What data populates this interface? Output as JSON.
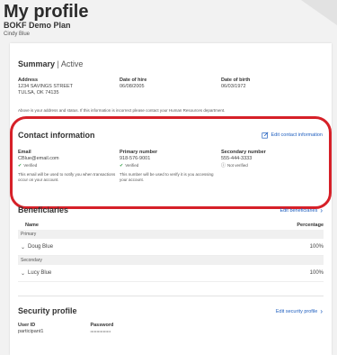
{
  "header": {
    "title": "My profile",
    "plan": "BOKF Demo Plan",
    "user": "Cindy Blue"
  },
  "summary": {
    "title": "Summary",
    "separator": "|",
    "status": "Active",
    "address_label": "Address",
    "address_line1": "1234 SAVINGS STREET",
    "address_line2": "TULSA, OK 74135",
    "hire_label": "Date of hire",
    "hire_value": "06/08/2005",
    "birth_label": "Date of birth",
    "birth_value": "06/03/1972",
    "note": "Above is your address and status. If this information is incorrect please contact your Human Resources department."
  },
  "contact": {
    "title": "Contact information",
    "edit_label": "Edit contact information",
    "email_label": "Email",
    "email_value": "CBlue@email.com",
    "email_status": "Verified",
    "email_note": "This email will be used to notify you when transactions occur on your account.",
    "primary_label": "Primary number",
    "primary_value": "918-576-9001",
    "primary_status": "Verified",
    "primary_note": "This number will be used to verify it is you accessing your account.",
    "secondary_label": "Secondary number",
    "secondary_value": "555-444-3333",
    "secondary_status": "Not verified"
  },
  "beneficiaries": {
    "title": "Beneficiaries",
    "edit_label": "Edit beneficiaries",
    "col_name": "Name",
    "col_percentage": "Percentage",
    "groups": [
      {
        "label": "Primary",
        "name": "Doug Blue",
        "percentage": "100%"
      },
      {
        "label": "Secondary",
        "name": "Lucy Blue",
        "percentage": "100%"
      }
    ]
  },
  "security": {
    "title": "Security profile",
    "edit_label": "Edit security profile",
    "user_id_label": "User ID",
    "user_id_value": "participant1",
    "password_label": "Password",
    "password_value": "••••••••••••••••"
  },
  "colors": {
    "accent": "#1f5fbf",
    "highlight": "#d62028",
    "verified": "#2f9e44"
  }
}
